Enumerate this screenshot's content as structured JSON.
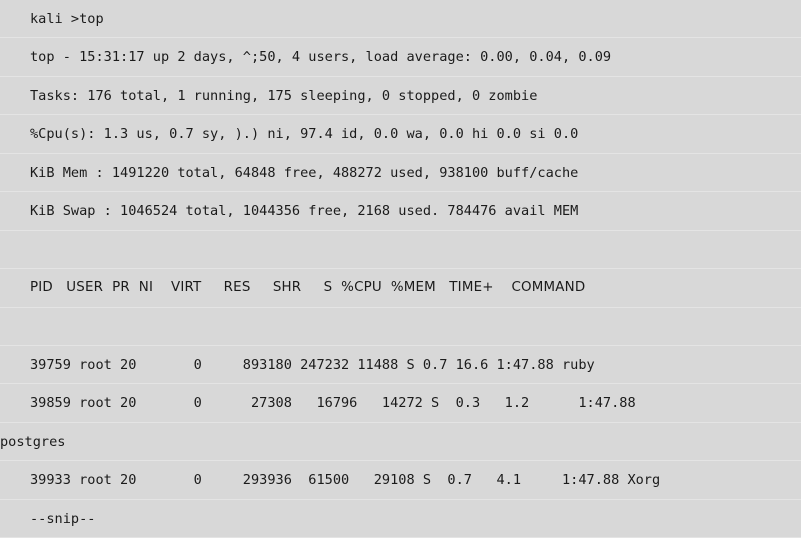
{
  "terminal": {
    "background_color": "#d8d8d8",
    "text_color": "#1b1b1b",
    "rule_color": "#e4e4e4",
    "prompt": "kali >top",
    "lines": [
      {
        "name": "prompt-line",
        "text": "kali >top",
        "kind": "prompt"
      },
      {
        "name": "top-summary-line",
        "text": "top - 15:31:17 up 2 days, ^;50, 4 users, load average: 0.00, 0.04, 0.09",
        "kind": "text"
      },
      {
        "name": "tasks-line",
        "text": "Tasks: 176 total, 1 running, 175 sleeping, 0 stopped, 0 zombie",
        "kind": "text"
      },
      {
        "name": "cpu-line",
        "text": "%Cpu(s): 1.3 us, 0.7 sy, ).) ni, 97.4 id, 0.0 wa, 0.0 hi 0.0 si 0.0",
        "kind": "text"
      },
      {
        "name": "mem-line",
        "text": "KiB Mem : 1491220 total, 64848 free, 488272 used, 938100 buff/cache",
        "kind": "text"
      },
      {
        "name": "swap-line",
        "text": "KiB Swap : 1046524 total, 1044356 free, 2168 used. 784476 avail MEM",
        "kind": "text"
      },
      {
        "name": "spacer-line",
        "text": "",
        "kind": "blank"
      },
      {
        "name": "process-table-header",
        "text": "PID   USER  PR  NI    VIRT     RES     SHR     S  %CPU  %MEM   TIME+    COMMAND",
        "kind": "colhead"
      },
      {
        "name": "spacer-line",
        "text": "",
        "kind": "blank"
      },
      {
        "name": "process-row-ruby",
        "text": "39759 root 20       0     893180 247232 11488 S 0.7 16.6 1:47.88 ruby",
        "kind": "text"
      },
      {
        "name": "process-row-postgres",
        "text": "39859 root 20       0      27308   16796   14272 S  0.3   1.2      1:47.88",
        "kind": "text"
      },
      {
        "name": "process-row-postgres-wrap",
        "text": "postgres",
        "kind": "wrap"
      },
      {
        "name": "process-row-xorg",
        "text": "39933 root 20       0     293936  61500   29108 S  0.7   4.1     1:47.88 Xorg",
        "kind": "text"
      },
      {
        "name": "snip-line",
        "text": "--snip--",
        "kind": "text"
      }
    ],
    "table": {
      "columns": [
        "PID",
        "USER",
        "PR",
        "NI",
        "VIRT",
        "RES",
        "SHR",
        "S",
        "%CPU",
        "%MEM",
        "TIME+",
        "COMMAND"
      ],
      "rows": [
        {
          "PID": "39759",
          "USER": "root",
          "PR": "20",
          "NI": "0",
          "VIRT": "893180",
          "RES": "247232",
          "SHR": "11488",
          "S": "S",
          "%CPU": "0.7",
          "%MEM": "16.6",
          "TIME+": "1:47.88",
          "COMMAND": "ruby"
        },
        {
          "PID": "39859",
          "USER": "root",
          "PR": "20",
          "NI": "0",
          "VIRT": "27308",
          "RES": "16796",
          "SHR": "14272",
          "S": "S",
          "%CPU": "0.3",
          "%MEM": "1.2",
          "TIME+": "1:47.88",
          "COMMAND": "postgres"
        },
        {
          "PID": "39933",
          "USER": "root",
          "PR": "20",
          "NI": "0",
          "VIRT": "293936",
          "RES": "61500",
          "SHR": "29108",
          "S": "S",
          "%CPU": "0.7",
          "%MEM": "4.1",
          "TIME+": "1:47.88",
          "COMMAND": "Xorg"
        }
      ]
    },
    "summary": {
      "time": "15:31:17",
      "uptime": "up 2 days, ^;50",
      "users": "4 users",
      "load_average": [
        "0.00",
        "0.04",
        "0.09"
      ],
      "tasks_total": "176",
      "tasks_running": "1",
      "tasks_sleeping": "175",
      "tasks_stopped": "0",
      "tasks_zombie": "0",
      "cpu_us": "1.3",
      "cpu_sy": "0.7",
      "cpu_ni": ").)",
      "cpu_id": "97.4",
      "cpu_wa": "0.0",
      "cpu_hi": "0.0",
      "cpu_si": "0.0",
      "cpu_st": "0.0",
      "mem_total": "1491220",
      "mem_free": "64848",
      "mem_used": "488272",
      "mem_buff_cache": "938100",
      "swap_total": "1046524",
      "swap_free": "1044356",
      "swap_used": "2168",
      "swap_avail_mem": "784476"
    }
  }
}
